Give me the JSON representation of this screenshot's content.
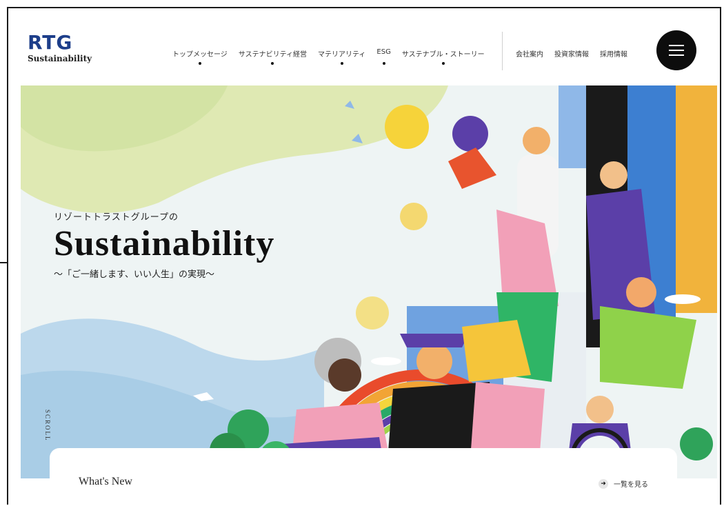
{
  "logo": {
    "mark": "RTG",
    "sub": "Sustainability"
  },
  "nav": {
    "primary": [
      "トップメッセージ",
      "サステナビリティ経営",
      "マテリアリティ",
      "ESG",
      "サステナブル・ストーリー"
    ],
    "secondary": [
      "会社案内",
      "投資家情報",
      "採用情報"
    ]
  },
  "hero": {
    "kicker": "リゾートトラストグループの",
    "title": "Sustainability",
    "subtitle": "～「ご一緒します、いい人生」の実現～",
    "scroll": "SCROLL"
  },
  "news": {
    "title": "What's New",
    "more": "一覧を見る"
  },
  "colors": {
    "brand": "#1d3e8a",
    "menu": "#0d0d0d"
  }
}
